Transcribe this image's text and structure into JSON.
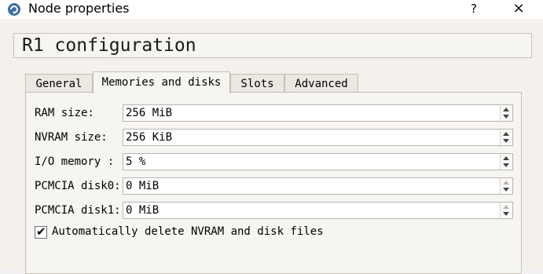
{
  "window": {
    "title": "Node properties",
    "help_label": "?",
    "close_label": "×"
  },
  "header": {
    "title": "R1 configuration"
  },
  "tabs": [
    {
      "label": "General",
      "active": false
    },
    {
      "label": "Memories and disks",
      "active": true
    },
    {
      "label": "Slots",
      "active": false
    },
    {
      "label": "Advanced",
      "active": false
    }
  ],
  "fields": [
    {
      "label": "RAM size:",
      "value": "256 MiB"
    },
    {
      "label": "NVRAM size:",
      "value": "256 KiB"
    },
    {
      "label": "I/O memory :",
      "value": "5 %"
    },
    {
      "label": "PCMCIA disk0:",
      "value": "0 MiB"
    },
    {
      "label": "PCMCIA disk1:",
      "value": "0 MiB"
    }
  ],
  "auto_delete": {
    "label": "Automatically delete NVRAM and disk files",
    "checked": true,
    "mark": "✔"
  },
  "icons": {
    "app": "gns3-app-icon"
  }
}
